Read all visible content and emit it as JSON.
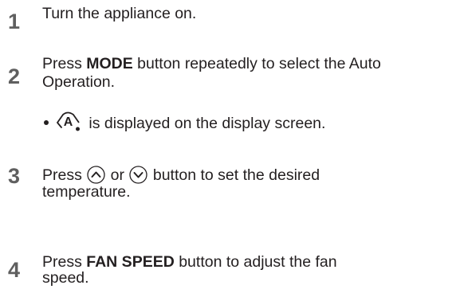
{
  "steps": [
    {
      "number": "1",
      "line1": "Turn the appliance on."
    },
    {
      "number": "2",
      "line1_pre": "Press ",
      "line1_bold": "MODE",
      "line1_post": " button repeatedly to select the Auto",
      "line2": "Operation.",
      "bullet": " is displayed on the display screen.",
      "bullet_icon": "auto-mode-icon",
      "bullet_icon_letter": "A"
    },
    {
      "number": "3",
      "line1_pre": "Press ",
      "line1_mid": " or ",
      "line1_post": " button to set the desired",
      "line2": "temperature.",
      "up_icon": "chevron-up-icon",
      "down_icon": "chevron-down-icon"
    },
    {
      "number": "4",
      "line1_pre": "Press ",
      "line1_bold": "FAN SPEED",
      "line1_post": " button to adjust the fan",
      "line2": "speed."
    }
  ]
}
